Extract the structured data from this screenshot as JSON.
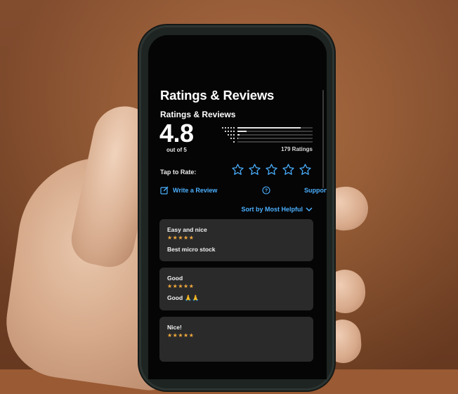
{
  "screen": {
    "large_title": "Ratings & Reviews",
    "section_title": "Ratings & Reviews",
    "average": "4.8",
    "out_of": "out of 5",
    "ratings_count": "179 Ratings",
    "distribution": [
      {
        "stars": 5,
        "fraction": 0.84
      },
      {
        "stars": 4,
        "fraction": 0.12
      },
      {
        "stars": 3,
        "fraction": 0.03
      },
      {
        "stars": 2,
        "fraction": 0.01
      },
      {
        "stars": 1,
        "fraction": 0.0
      }
    ],
    "tap_to_rate": "Tap to Rate:",
    "write_review": "Write a Review",
    "support": "Support",
    "sort": "Sort by Most Helpful",
    "reviews": [
      {
        "title": "Easy and nice",
        "stars": "★★★★★",
        "body": "Best micro stock"
      },
      {
        "title": "Good",
        "stars": "★★★★★",
        "body": "Good 🙏🙏"
      },
      {
        "title": "Nice!",
        "stars": "★★★★★",
        "body": ""
      }
    ]
  },
  "colors": {
    "accent": "#4bb0ff",
    "star_fill": "#f0a93c",
    "screen_bg": "#050505",
    "card_bg": "#2a2a2b"
  },
  "icons": [
    "compose-icon",
    "question-circle-icon",
    "chevron-down-icon",
    "star-outline-icon"
  ]
}
